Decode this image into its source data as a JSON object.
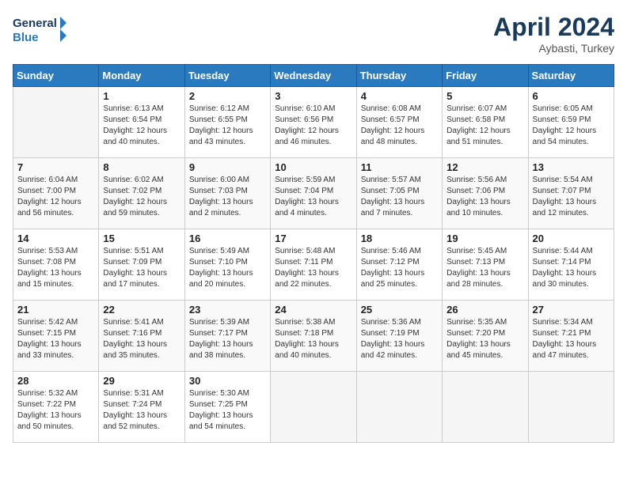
{
  "header": {
    "logo_line1": "General",
    "logo_line2": "Blue",
    "month": "April 2024",
    "location": "Aybasti, Turkey"
  },
  "days_of_week": [
    "Sunday",
    "Monday",
    "Tuesday",
    "Wednesday",
    "Thursday",
    "Friday",
    "Saturday"
  ],
  "weeks": [
    [
      {
        "day": "",
        "info": ""
      },
      {
        "day": "1",
        "info": "Sunrise: 6:13 AM\nSunset: 6:54 PM\nDaylight: 12 hours\nand 40 minutes."
      },
      {
        "day": "2",
        "info": "Sunrise: 6:12 AM\nSunset: 6:55 PM\nDaylight: 12 hours\nand 43 minutes."
      },
      {
        "day": "3",
        "info": "Sunrise: 6:10 AM\nSunset: 6:56 PM\nDaylight: 12 hours\nand 46 minutes."
      },
      {
        "day": "4",
        "info": "Sunrise: 6:08 AM\nSunset: 6:57 PM\nDaylight: 12 hours\nand 48 minutes."
      },
      {
        "day": "5",
        "info": "Sunrise: 6:07 AM\nSunset: 6:58 PM\nDaylight: 12 hours\nand 51 minutes."
      },
      {
        "day": "6",
        "info": "Sunrise: 6:05 AM\nSunset: 6:59 PM\nDaylight: 12 hours\nand 54 minutes."
      }
    ],
    [
      {
        "day": "7",
        "info": "Sunrise: 6:04 AM\nSunset: 7:00 PM\nDaylight: 12 hours\nand 56 minutes."
      },
      {
        "day": "8",
        "info": "Sunrise: 6:02 AM\nSunset: 7:02 PM\nDaylight: 12 hours\nand 59 minutes."
      },
      {
        "day": "9",
        "info": "Sunrise: 6:00 AM\nSunset: 7:03 PM\nDaylight: 13 hours\nand 2 minutes."
      },
      {
        "day": "10",
        "info": "Sunrise: 5:59 AM\nSunset: 7:04 PM\nDaylight: 13 hours\nand 4 minutes."
      },
      {
        "day": "11",
        "info": "Sunrise: 5:57 AM\nSunset: 7:05 PM\nDaylight: 13 hours\nand 7 minutes."
      },
      {
        "day": "12",
        "info": "Sunrise: 5:56 AM\nSunset: 7:06 PM\nDaylight: 13 hours\nand 10 minutes."
      },
      {
        "day": "13",
        "info": "Sunrise: 5:54 AM\nSunset: 7:07 PM\nDaylight: 13 hours\nand 12 minutes."
      }
    ],
    [
      {
        "day": "14",
        "info": "Sunrise: 5:53 AM\nSunset: 7:08 PM\nDaylight: 13 hours\nand 15 minutes."
      },
      {
        "day": "15",
        "info": "Sunrise: 5:51 AM\nSunset: 7:09 PM\nDaylight: 13 hours\nand 17 minutes."
      },
      {
        "day": "16",
        "info": "Sunrise: 5:49 AM\nSunset: 7:10 PM\nDaylight: 13 hours\nand 20 minutes."
      },
      {
        "day": "17",
        "info": "Sunrise: 5:48 AM\nSunset: 7:11 PM\nDaylight: 13 hours\nand 22 minutes."
      },
      {
        "day": "18",
        "info": "Sunrise: 5:46 AM\nSunset: 7:12 PM\nDaylight: 13 hours\nand 25 minutes."
      },
      {
        "day": "19",
        "info": "Sunrise: 5:45 AM\nSunset: 7:13 PM\nDaylight: 13 hours\nand 28 minutes."
      },
      {
        "day": "20",
        "info": "Sunrise: 5:44 AM\nSunset: 7:14 PM\nDaylight: 13 hours\nand 30 minutes."
      }
    ],
    [
      {
        "day": "21",
        "info": "Sunrise: 5:42 AM\nSunset: 7:15 PM\nDaylight: 13 hours\nand 33 minutes."
      },
      {
        "day": "22",
        "info": "Sunrise: 5:41 AM\nSunset: 7:16 PM\nDaylight: 13 hours\nand 35 minutes."
      },
      {
        "day": "23",
        "info": "Sunrise: 5:39 AM\nSunset: 7:17 PM\nDaylight: 13 hours\nand 38 minutes."
      },
      {
        "day": "24",
        "info": "Sunrise: 5:38 AM\nSunset: 7:18 PM\nDaylight: 13 hours\nand 40 minutes."
      },
      {
        "day": "25",
        "info": "Sunrise: 5:36 AM\nSunset: 7:19 PM\nDaylight: 13 hours\nand 42 minutes."
      },
      {
        "day": "26",
        "info": "Sunrise: 5:35 AM\nSunset: 7:20 PM\nDaylight: 13 hours\nand 45 minutes."
      },
      {
        "day": "27",
        "info": "Sunrise: 5:34 AM\nSunset: 7:21 PM\nDaylight: 13 hours\nand 47 minutes."
      }
    ],
    [
      {
        "day": "28",
        "info": "Sunrise: 5:32 AM\nSunset: 7:22 PM\nDaylight: 13 hours\nand 50 minutes."
      },
      {
        "day": "29",
        "info": "Sunrise: 5:31 AM\nSunset: 7:24 PM\nDaylight: 13 hours\nand 52 minutes."
      },
      {
        "day": "30",
        "info": "Sunrise: 5:30 AM\nSunset: 7:25 PM\nDaylight: 13 hours\nand 54 minutes."
      },
      {
        "day": "",
        "info": ""
      },
      {
        "day": "",
        "info": ""
      },
      {
        "day": "",
        "info": ""
      },
      {
        "day": "",
        "info": ""
      }
    ]
  ]
}
